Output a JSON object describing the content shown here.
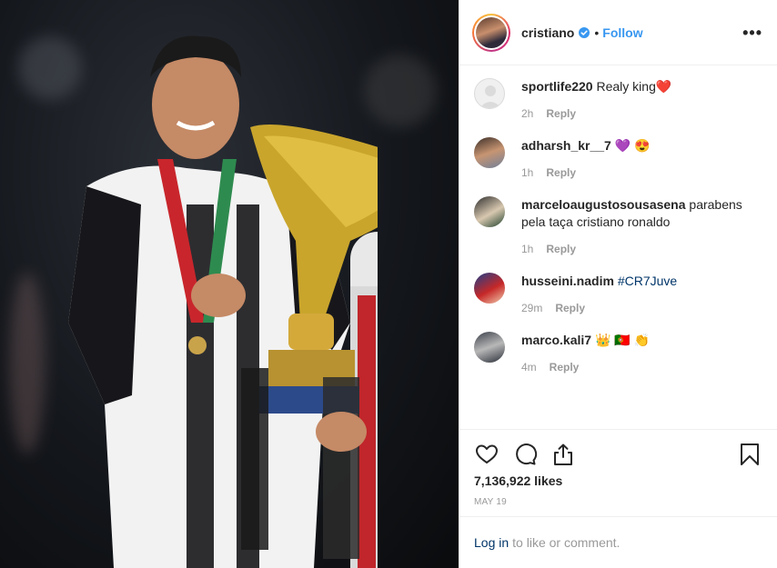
{
  "post": {
    "username": "cristiano",
    "separator": "•",
    "follow_label": "Follow",
    "more_label": "•••",
    "likes": "7,136,922 likes",
    "date": "MAY 19"
  },
  "comments": [
    {
      "user": "sportlife220",
      "text": "Realy king❤️",
      "time": "2h",
      "reply": "Reply"
    },
    {
      "user": "adharsh_kr__7",
      "text": "💜 😍",
      "time": "1h",
      "reply": "Reply"
    },
    {
      "user": "marceloaugustosousasena",
      "text": "parabens pela taça cristiano ronaldo",
      "time": "1h",
      "reply": "Reply"
    },
    {
      "user": "husseini.nadim",
      "text": "#CR7Juve",
      "time": "29m",
      "reply": "Reply"
    },
    {
      "user": "marco.kali7",
      "text": "👑 🇵🇹 👏",
      "time": "4m",
      "reply": "Reply"
    }
  ],
  "footer": {
    "login_label": "Log in",
    "login_suffix": "to like or comment."
  },
  "colors": {
    "link_blue": "#3897f0",
    "hashtag": "#003569",
    "muted": "#999999"
  },
  "icons": [
    "verified-badge-icon",
    "heart-icon",
    "comment-icon",
    "share-icon",
    "bookmark-icon"
  ]
}
